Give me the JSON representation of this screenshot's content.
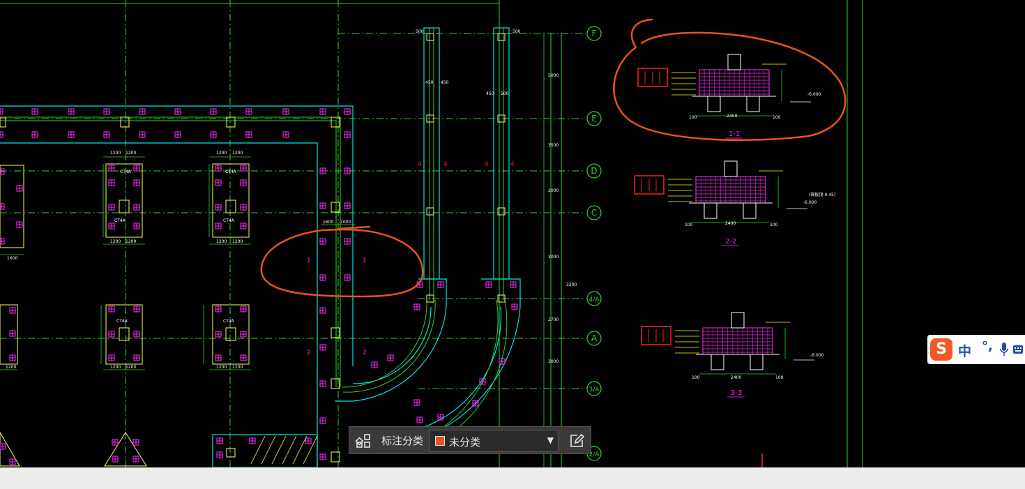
{
  "drawing": {
    "axis_labels": [
      "F",
      "E",
      "D",
      "C",
      "4/A",
      "A",
      "3/A",
      "2/A"
    ],
    "section_titles": [
      "1-1",
      "2-2",
      "3-3"
    ],
    "column_tags": [
      "CT4A",
      "CT4A",
      "CT4A",
      "CT4A",
      "CT4A",
      "CT4A"
    ],
    "dims": {
      "d1200": "1200",
      "d2400": "2400",
      "d100": "100",
      "d500": "500",
      "d450": "450",
      "d1000": "1000",
      "d1600": "1600",
      "d3000": "3000",
      "d5000": "5000",
      "d3500": "3500",
      "d2000": "2000",
      "d2700": "2700",
      "d3200": "3200",
      "elev1": "-6.000",
      "elev2": "(筏板顶-0.45)",
      "elev3": "-6.000"
    },
    "bay_marks": [
      "1",
      "1",
      "2",
      "2",
      "4",
      "4",
      "4",
      "4"
    ],
    "colors": {
      "grid": "#2fd22f",
      "wall": "#00e6e6",
      "pile": "#ff2bff",
      "column": "#ffff5a",
      "annot": "#ffff00",
      "red": "#ff2020",
      "markup": "#e8541c"
    }
  },
  "annotation_toolbar": {
    "grid_icon": "grid-view-icon",
    "label": "标注分类",
    "category_value": "未分类",
    "category_color": "#e8541c",
    "dropdown_icon": "chevron-down-icon",
    "edit_icon": "edit-note-icon"
  },
  "ime": {
    "logo": "S",
    "mode": "中",
    "punct": "°,"
  }
}
